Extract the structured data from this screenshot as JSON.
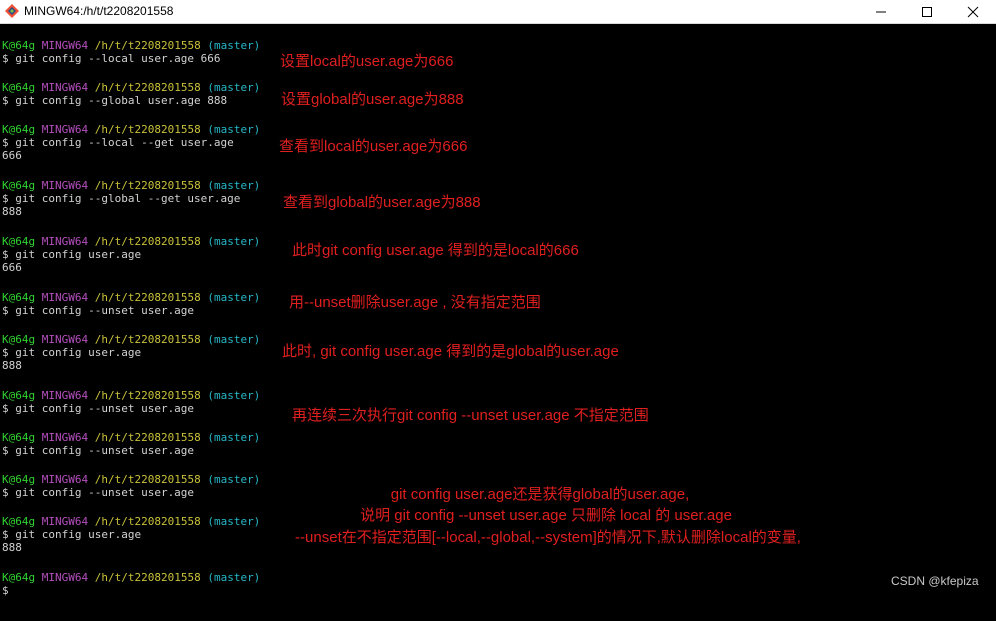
{
  "window": {
    "title": "MINGW64:/h/t/t2208201558",
    "app_icon": "git-bash-icon",
    "buttons": [
      "minimize-icon",
      "maximize-icon",
      "close-icon"
    ]
  },
  "colors": {
    "prompt_user": "#2fd12f",
    "prompt_shell": "#b64fbf",
    "prompt_path": "#c9c23a",
    "prompt_branch": "#28b7c7",
    "annotation": "#e01f1f"
  },
  "prompt": {
    "user": "K@64g",
    "shell": "MINGW64",
    "path": "/h/t/t2208201558",
    "branch": "(master)"
  },
  "terminal": {
    "blocks": [
      {
        "command": "$ git config --local user.age 666",
        "output": ""
      },
      {
        "command": "$ git config --global user.age 888",
        "output": ""
      },
      {
        "command": "$ git config --local --get user.age",
        "output": "666"
      },
      {
        "command": "$ git config --global --get user.age",
        "output": "888"
      },
      {
        "command": "$ git config user.age",
        "output": "666"
      },
      {
        "command": "$ git config --unset user.age",
        "output": ""
      },
      {
        "command": "$ git config user.age",
        "output": "888"
      },
      {
        "command": "$ git config --unset user.age",
        "output": ""
      },
      {
        "command": "$ git config --unset user.age",
        "output": ""
      },
      {
        "command": "$ git config --unset user.age",
        "output": ""
      },
      {
        "command": "$ git config user.age",
        "output": "888"
      },
      {
        "command": "$",
        "output": ""
      }
    ]
  },
  "annotations": [
    "设置local的user.age为666",
    "设置global的user.age为888",
    "查看到local的user.age为666",
    "查看到global的user.age为888",
    "此时git config user.age 得到的是local的666",
    "用--unset删除user.age , 没有指定范围",
    "此时, git config user.age 得到的是global的user.age",
    "再连续三次执行git config --unset user.age 不指定范围",
    "git config user.age还是获得global的user.age,",
    "说明 git config --unset user.age 只删除 local 的 user.age",
    "--unset在不指定范围[--local,--global,--system]的情况下,默认删除local的变量,"
  ],
  "watermark": "CSDN @kfepiza"
}
